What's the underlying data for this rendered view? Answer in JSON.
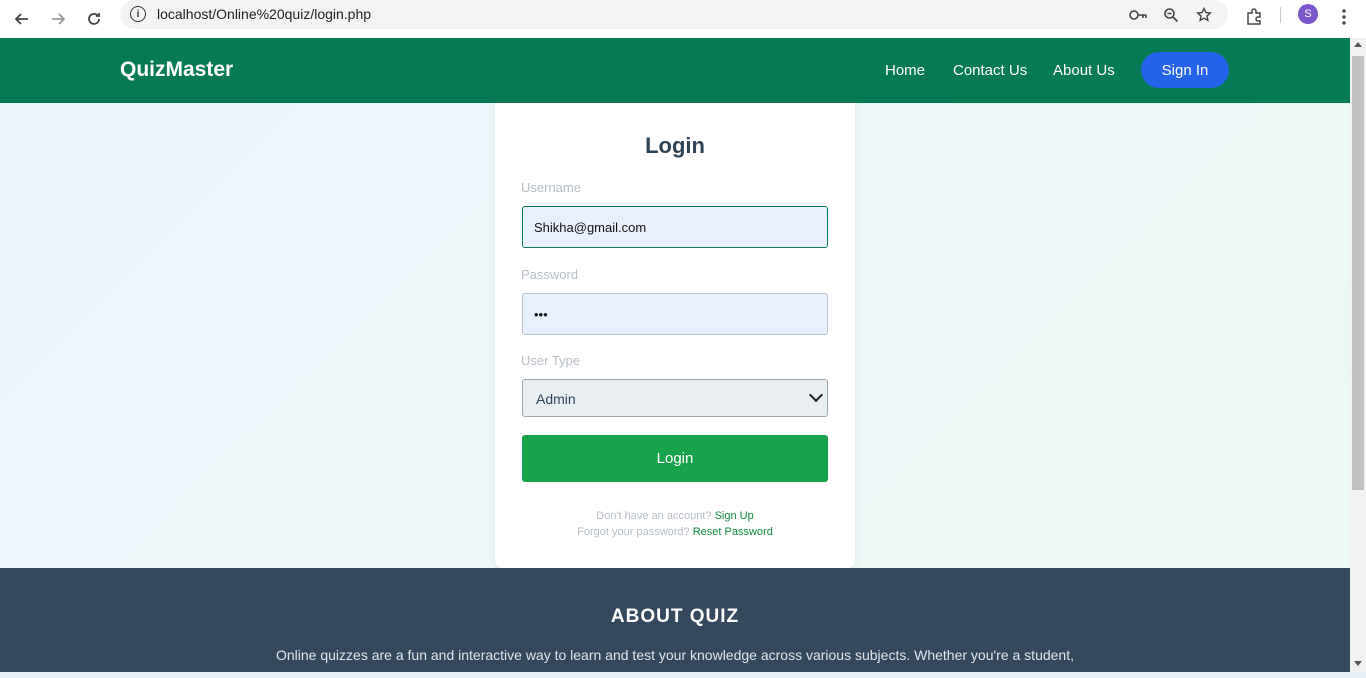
{
  "browser": {
    "url": "localhost/Online%20quiz/login.php",
    "profile_initial": "S",
    "icons": {
      "back": "back-arrow-icon",
      "forward": "forward-arrow-icon",
      "reload": "reload-icon",
      "site_info": "site-info-icon",
      "password_key": "key-icon",
      "zoom": "zoom-icon",
      "bookmark": "star-icon",
      "extensions": "puzzle-icon",
      "menu": "kebab-menu-icon"
    }
  },
  "header": {
    "brand": "QuizMaster",
    "nav": [
      "Home",
      "Contact Us",
      "About Us"
    ],
    "signin_label": "Sign In",
    "bg_color": "#067a55",
    "signin_color": "#2563eb"
  },
  "login": {
    "title": "Login",
    "username_label": "Username",
    "username_value": "Shikha@gmail.com",
    "password_label": "Password",
    "password_value": "•••",
    "usertype_label": "User Type",
    "usertype_value": "Admin",
    "submit_label": "Login",
    "submit_color": "#16a34a",
    "signup_prompt": "Don't have an account?",
    "signup_link": "Sign Up",
    "forgot_prompt": "Forgot your password?",
    "reset_link": "Reset Password"
  },
  "footer": {
    "title": "ABOUT QUIZ",
    "text": "Online quizzes are a fun and interactive way to learn and test your knowledge across various subjects. Whether you're a student,",
    "bg_color": "#34495e"
  }
}
